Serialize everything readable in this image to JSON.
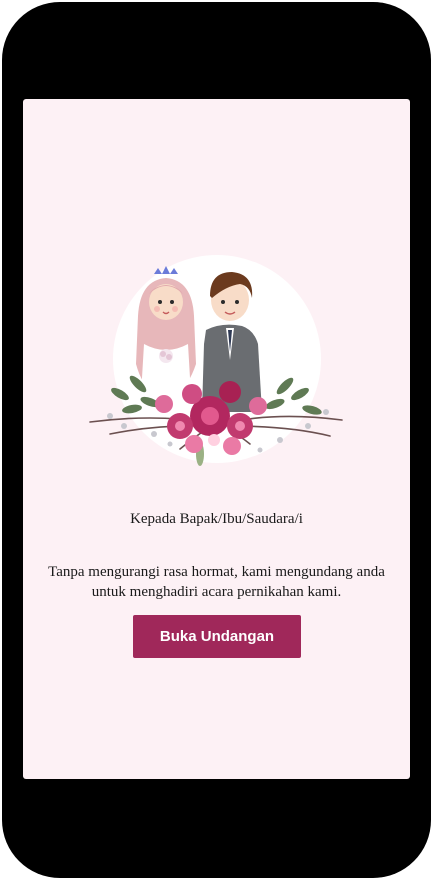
{
  "invitation": {
    "greeting": "Kepada Bapak/Ibu/Saudara/i",
    "message": "Tanpa mengurangi rasa hormat, kami mengundang anda untuk menghadiri acara pernikahan kami.",
    "open_button_label": "Buka Undangan"
  },
  "colors": {
    "background": "#fdf1f5",
    "button": "#a0285a",
    "button_text": "#ffffff"
  }
}
